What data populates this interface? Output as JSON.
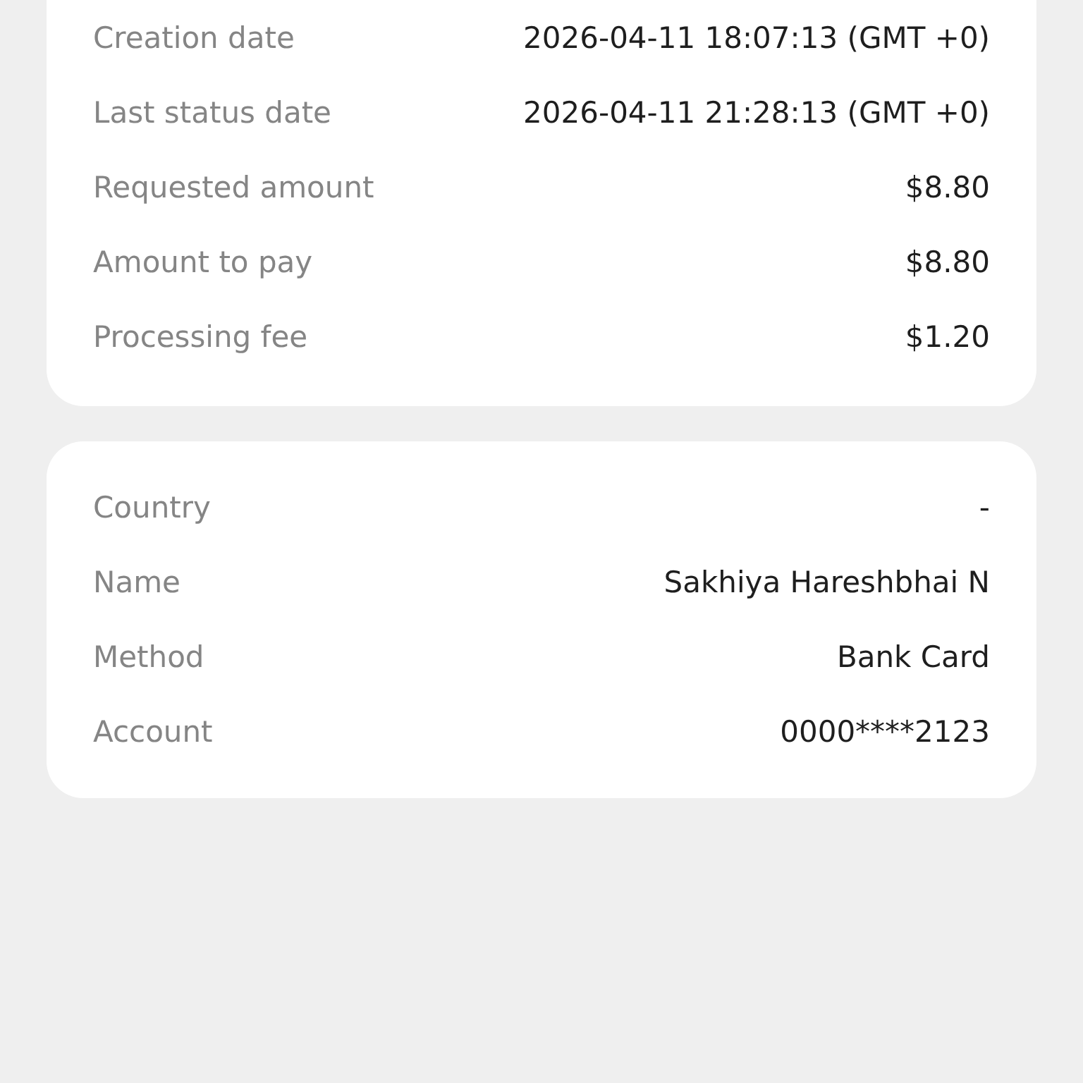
{
  "cards": [
    {
      "rows": [
        {
          "label": "Creation date",
          "value": "2026-04-11 18:07:13 (GMT +0)"
        },
        {
          "label": "Last status date",
          "value": "2026-04-11 21:28:13 (GMT +0)"
        },
        {
          "label": "Requested amount",
          "value": "$8.80"
        },
        {
          "label": "Amount to pay",
          "value": "$8.80"
        },
        {
          "label": "Processing fee",
          "value": "$1.20"
        }
      ]
    },
    {
      "rows": [
        {
          "label": "Country",
          "value": "-"
        },
        {
          "label": "Name",
          "value": "Sakhiya Hareshbhai N"
        },
        {
          "label": "Method",
          "value": "Bank Card"
        },
        {
          "label": "Account",
          "value": "0000****2123"
        }
      ]
    }
  ]
}
